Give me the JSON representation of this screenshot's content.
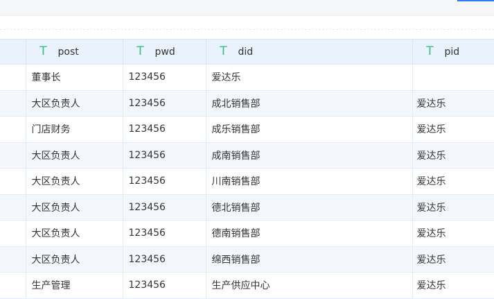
{
  "columns": [
    {
      "label": "post",
      "type_icon": "text-type-icon"
    },
    {
      "label": "pwd",
      "type_icon": "text-type-icon"
    },
    {
      "label": "did",
      "type_icon": "text-type-icon"
    },
    {
      "label": "pid",
      "type_icon": "text-type-icon"
    }
  ],
  "rows": [
    {
      "post": "董事长",
      "pwd": "123456",
      "did": "爱达乐",
      "pid": ""
    },
    {
      "post": "大区负责人",
      "pwd": "123456",
      "did": "成北销售部",
      "pid": "爱达乐"
    },
    {
      "post": "门店财务",
      "pwd": "123456",
      "did": "成乐销售部",
      "pid": "爱达乐"
    },
    {
      "post": "大区负责人",
      "pwd": "123456",
      "did": "成南销售部",
      "pid": "爱达乐"
    },
    {
      "post": "大区负责人",
      "pwd": "123456",
      "did": "川南销售部",
      "pid": "爱达乐"
    },
    {
      "post": "大区负责人",
      "pwd": "123456",
      "did": "德北销售部",
      "pid": "爱达乐"
    },
    {
      "post": "大区负责人",
      "pwd": "123456",
      "did": "德南销售部",
      "pid": "爱达乐"
    },
    {
      "post": "大区负责人",
      "pwd": "123456",
      "did": "绵西销售部",
      "pid": "爱达乐"
    },
    {
      "post": "生产管理",
      "pwd": "123456",
      "did": "生产供应中心",
      "pid": "爱达乐"
    }
  ],
  "colors": {
    "header_bg": "#eaf2fd",
    "stripe_bg": "#f4f8fd",
    "type_icon": "#32c27a",
    "accent": "#2f7cf6"
  }
}
